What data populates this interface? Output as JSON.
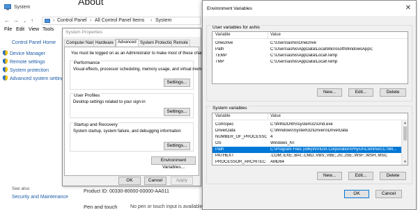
{
  "system_window": {
    "title": "System",
    "about_heading": "About",
    "nav": {
      "back": "←",
      "forward": "→",
      "up": "↑"
    },
    "address": {
      "crumbs": [
        "Control Panel",
        "All Control Panel Items",
        "System"
      ],
      "separator": "›"
    },
    "menu": [
      "File",
      "Edit",
      "View",
      "Tools"
    ],
    "left_pane": {
      "home": "Control Panel Home",
      "links": [
        "Device Manager",
        "Remote settings",
        "System protection",
        "Advanced system settings"
      ],
      "see_also": "See also",
      "security_maintenance": "Security and Maintenance"
    },
    "product_id": "Product ID: 00330-80000-00000-AA011",
    "pen_touch_label": "Pen and touch",
    "pen_touch_value": "No pen or touch input is available for this display"
  },
  "system_properties": {
    "title": "System Properties",
    "tabs": [
      "Computer Name",
      "Hardware",
      "Advanced",
      "System Protection",
      "Remote"
    ],
    "active_tab": "Advanced",
    "admin_note": "You must be logged on as an Administrator to make most of these changes.",
    "groups": [
      {
        "title": "Performance",
        "desc": "Visual effects, processor scheduling, memory usage, and virtual memory",
        "button": "Settings..."
      },
      {
        "title": "User Profiles",
        "desc": "Desktop settings related to your sign-in",
        "button": "Settings..."
      },
      {
        "title": "Startup and Recovery",
        "desc": "System startup, system failure, and debugging information",
        "button": "Settings..."
      }
    ],
    "env_button": "Environment Variables...",
    "ok": "OK",
    "cancel": "Cancel",
    "apply": "Apply"
  },
  "env_variables": {
    "title": "Environment Variables",
    "close_glyph": "✕",
    "user_group_title": "User variables for ashis",
    "col_variable": "Variable",
    "col_value": "Value",
    "user_vars": [
      {
        "name": "OneDrive",
        "value": "C:\\Users\\ashis\\OneDrive"
      },
      {
        "name": "Path",
        "value": "C:\\Users\\ashis\\AppData\\Local\\Microsoft\\WindowsApps;"
      },
      {
        "name": "TEMP",
        "value": "C:\\Users\\ashis\\AppData\\Local\\Temp"
      },
      {
        "name": "TMP",
        "value": "C:\\Users\\ashis\\AppData\\Local\\Temp"
      }
    ],
    "system_group_title": "System variables",
    "system_vars": [
      {
        "name": "ComSpec",
        "value": "C:\\WINDOWS\\system32\\cmd.exe"
      },
      {
        "name": "DriverData",
        "value": "C:\\Windows\\System32\\Drivers\\DriverData"
      },
      {
        "name": "NUMBER_OF_PROCESSORS",
        "value": "4"
      },
      {
        "name": "OS",
        "value": "Windows_NT"
      },
      {
        "name": "Path",
        "value": "C:\\Program Files (x86)\\NVIDIA Corporation\\PhysX\\Common;C:\\Wi..."
      },
      {
        "name": "PATHEXT",
        "value": ".COM;.EXE;.BAT;.CMD;.VBS;.VBE;.JS;.JSE;.WSF;.WSH;.MSC"
      },
      {
        "name": "PROCESSOR_ARCHITECTURE",
        "value": "AMD64"
      }
    ],
    "selected_system_var": "Path",
    "btn_new": "New...",
    "btn_edit": "Edit...",
    "btn_delete": "Delete",
    "ok": "OK",
    "cancel": "Cancel"
  },
  "colors": {
    "link": "#1a5aa8",
    "selection": "#0078d7",
    "dialog_bg": "#f0f0f0"
  }
}
